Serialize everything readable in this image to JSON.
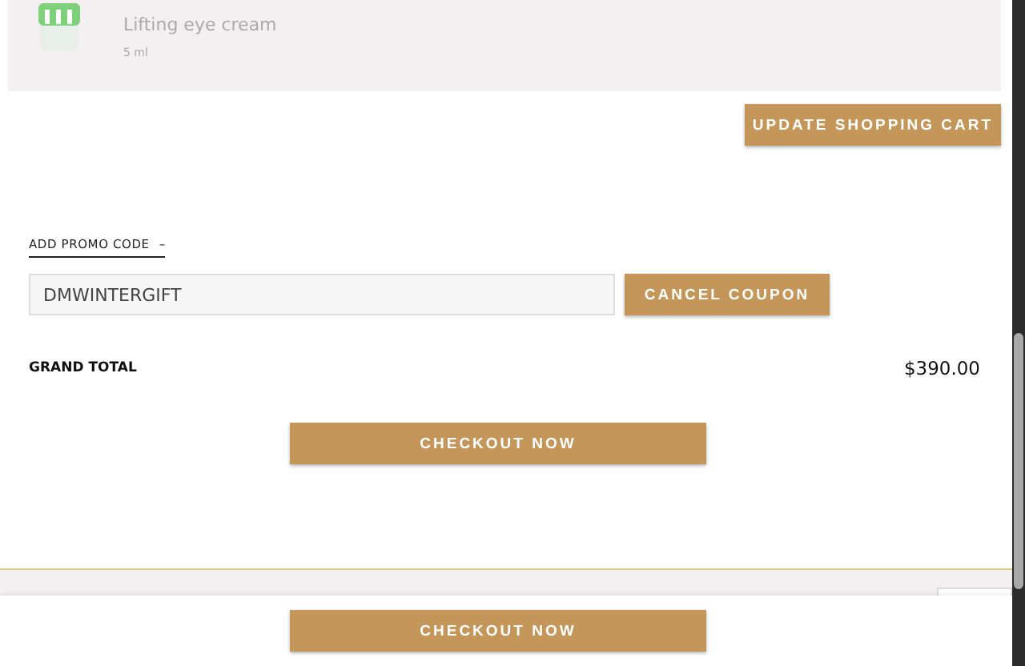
{
  "product": {
    "description": "Lifting eye cream",
    "size": "5 ml"
  },
  "update_button": "UPDATE SHOPPING CART",
  "promo": {
    "label": "ADD PROMO CODE",
    "toggle": "–",
    "expanded": true,
    "code": "DMWINTERGIFT",
    "cancel_button": "CANCEL COUPON"
  },
  "grand_total": {
    "label": "GRAND TOTAL",
    "value": "$390.00"
  },
  "checkout_button": "CHECKOUT NOW",
  "sticky_bar": {
    "checkout_button": "CHECKOUT NOW"
  }
}
